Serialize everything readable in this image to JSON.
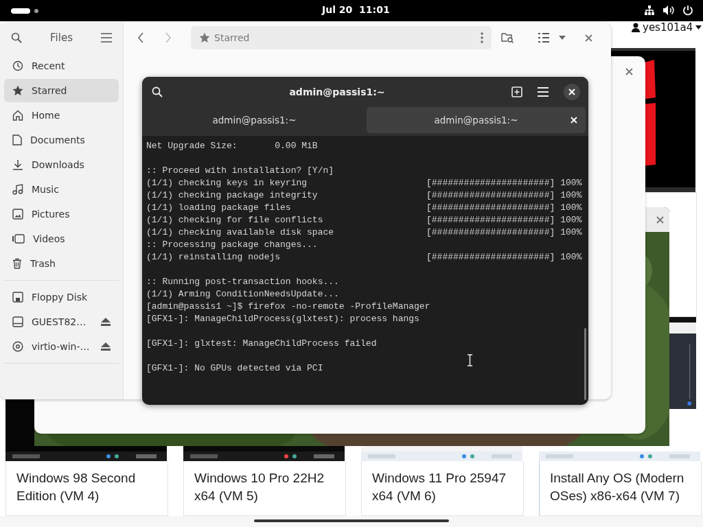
{
  "top_bar": {
    "clock": "Jul 20  11:01"
  },
  "user_menu": {
    "name": "yes101a4"
  },
  "files": {
    "title": "Files",
    "path": "Starred",
    "places": [
      {
        "label": "Recent",
        "selected": false
      },
      {
        "label": "Starred",
        "selected": true
      },
      {
        "label": "Home",
        "selected": false
      },
      {
        "label": "Documents",
        "selected": false
      },
      {
        "label": "Downloads",
        "selected": false
      },
      {
        "label": "Music",
        "selected": false
      },
      {
        "label": "Pictures",
        "selected": false
      },
      {
        "label": "Videos",
        "selected": false
      },
      {
        "label": "Trash",
        "selected": false
      }
    ],
    "devices": [
      {
        "label": "Floppy Disk",
        "eject": false
      },
      {
        "label": "GUEST82…",
        "eject": true
      },
      {
        "label": "virtio-win-…",
        "eject": true
      }
    ]
  },
  "terminal": {
    "title": "admin@passis1:~",
    "tabs": [
      {
        "label": "admin@passis1:~",
        "selected": false
      },
      {
        "label": "admin@passis1:~",
        "selected": true
      }
    ],
    "lines": [
      {
        "text": "Net Upgrade Size:       0.00 MiB"
      },
      {
        "text": ":: Proceed with installation? [Y/n]",
        "blank_before": true
      },
      {
        "text": "(1/1) checking keys in keyring",
        "bar": "[######################]",
        "percent": "100%"
      },
      {
        "text": "(1/1) checking package integrity",
        "bar": "[######################]",
        "percent": "100%"
      },
      {
        "text": "(1/1) loading package files",
        "bar": "[######################]",
        "percent": "100%"
      },
      {
        "text": "(1/1) checking for file conflicts",
        "bar": "[######################]",
        "percent": "100%"
      },
      {
        "text": "(1/1) checking available disk space",
        "bar": "[######################]",
        "percent": "100%"
      },
      {
        "text": ":: Processing package changes..."
      },
      {
        "text": "(1/1) reinstalling nodejs",
        "bar": "[######################]",
        "percent": "100%"
      },
      {
        "text": ":: Running post-transaction hooks...",
        "blank_before": true
      },
      {
        "text": "(1/1) Arming ConditionNeedsUpdate..."
      },
      {
        "text": "[admin@passis1 ~]$ firefox -no-remote -ProfileManager"
      },
      {
        "text": "[GFX1-]: ManageChildProcess(glxtest): process hangs"
      },
      {
        "text": "[GFX1-]: glxtest: ManageChildProcess failed",
        "blank_before": true
      },
      {
        "text": "[GFX1-]: No GPUs detected via PCI",
        "blank_before": true
      }
    ]
  },
  "thumbnails": [
    {
      "caption": [
        "Windows 98 Second",
        "Edition (VM 4)"
      ]
    },
    {
      "caption": [
        "Windows 10 Pro 22H2",
        "x64 (VM 5)"
      ]
    },
    {
      "caption": [
        "Windows 11 Pro 25947",
        "x64 (VM 6)"
      ]
    },
    {
      "caption": [
        "Install Any OS (Modern",
        "OSes) x86-x64 (VM 7)"
      ]
    }
  ]
}
